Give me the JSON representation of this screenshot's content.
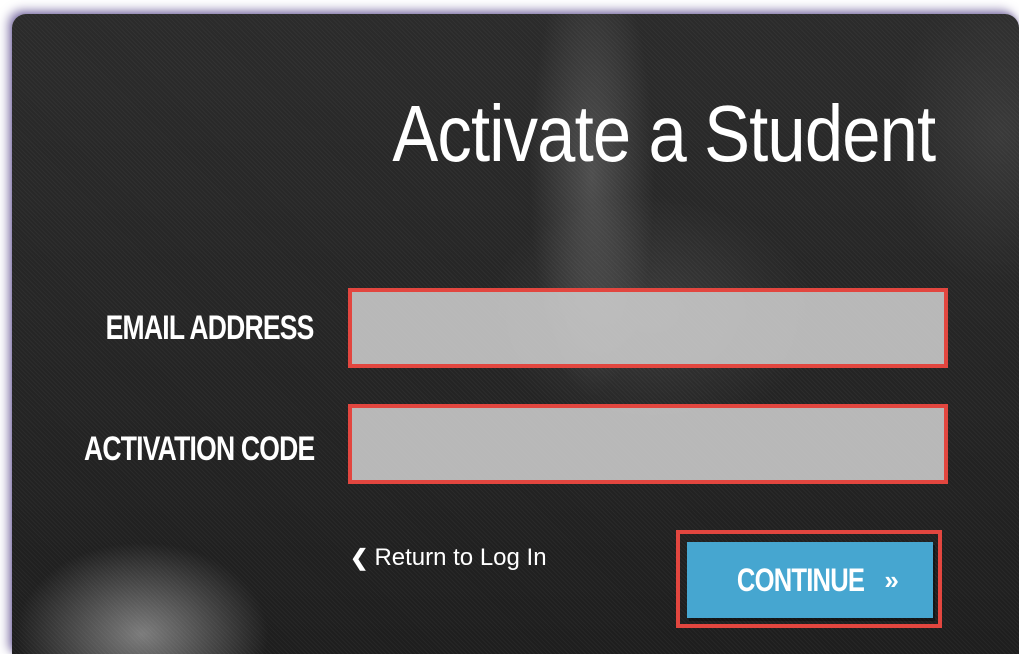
{
  "page": {
    "title": "Activate a Student"
  },
  "form": {
    "email_label": "EMAIL ADDRESS",
    "email_value": "",
    "code_label": "ACTIVATION CODE",
    "code_value": "",
    "return_link": "Return to Log In",
    "return_icon": "chevron-left-icon",
    "continue_label": "CONTINUE",
    "continue_icon": "double-chevron-right-icon"
  },
  "colors": {
    "panel_background": "#242424",
    "highlight_border": "#e2463f",
    "button_background": "#46a6d0",
    "field_background": "#cdcdcd",
    "text": "#ffffff"
  }
}
